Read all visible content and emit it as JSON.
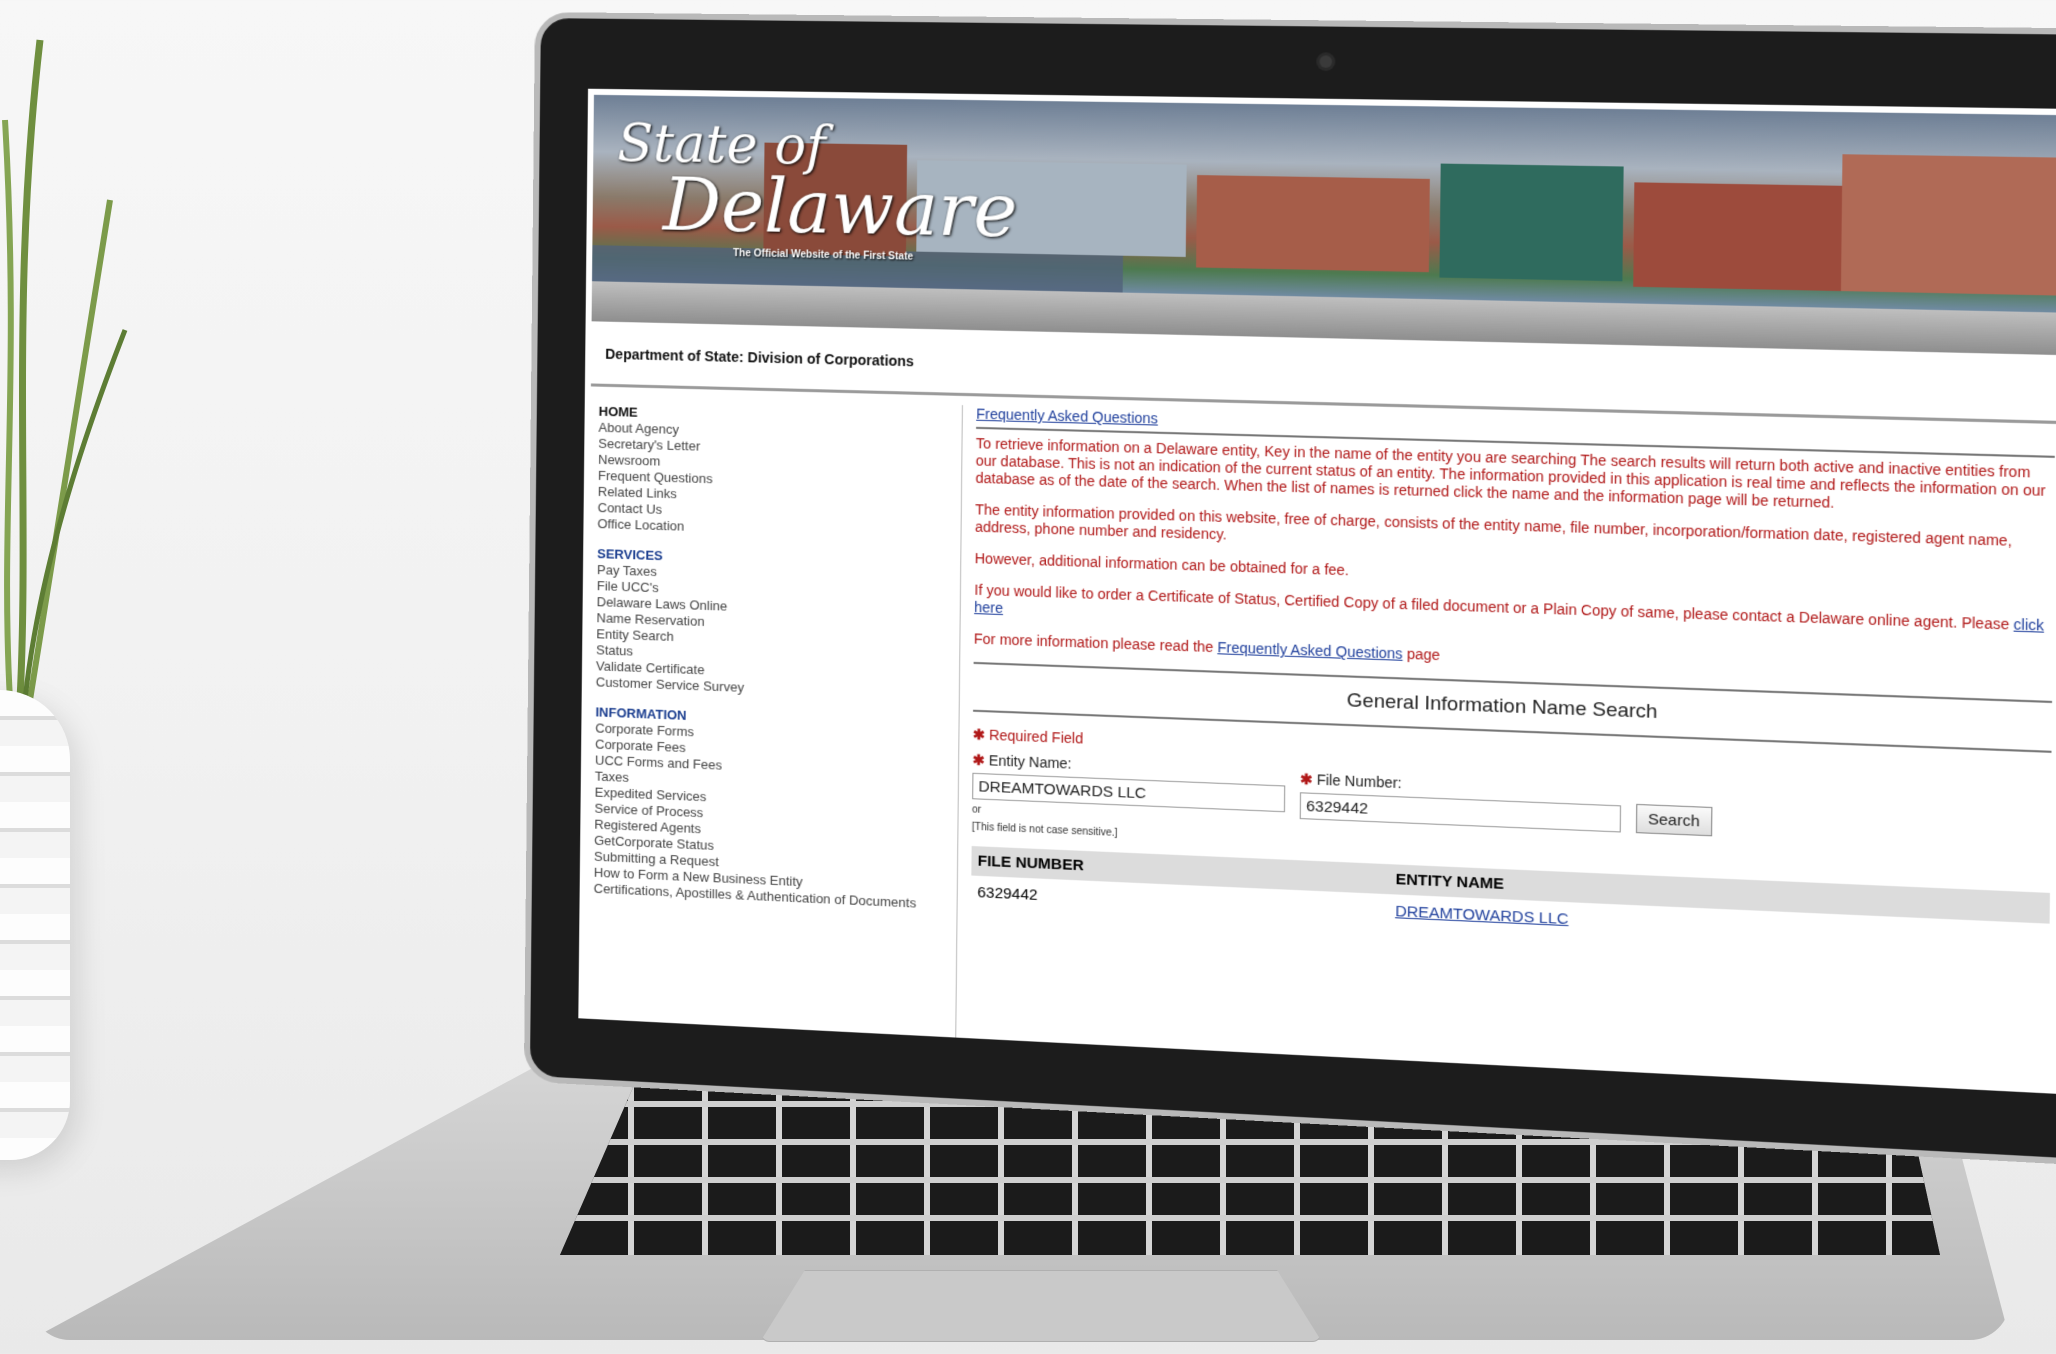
{
  "site": {
    "logo_state": "State of",
    "logo_name": "Delaware",
    "logo_tagline": "The Official Website of the First State",
    "department": "Department of State: Division of Corporations"
  },
  "nav": {
    "home": "HOME",
    "home_items": [
      "About Agency",
      "Secretary's Letter",
      "Newsroom",
      "Frequent Questions",
      "Related Links",
      "Contact Us",
      "Office Location"
    ],
    "services": "SERVICES",
    "services_items": [
      "Pay Taxes",
      "File UCC's",
      "Delaware Laws Online",
      "Name Reservation",
      "Entity Search",
      "Status",
      "Validate Certificate",
      "Customer Service Survey"
    ],
    "information": "INFORMATION",
    "information_items": [
      "Corporate Forms",
      "Corporate Fees",
      "UCC Forms and Fees",
      "Taxes",
      "Expedited Services",
      "Service of Process",
      "Registered Agents",
      "GetCorporate Status",
      "Submitting a Request",
      "How to Form a New Business Entity",
      "Certifications, Apostilles & Authentication of Documents"
    ]
  },
  "content": {
    "faq_link": "Frequently Asked Questions",
    "para1": "To retrieve information on a Delaware entity, Key in the name of the entity you are searching The search results will return both active and inactive entities from our database. This is not an indication of the current status of an entity. The information provided in this application is real time and reflects the information on our database as of the date of the search. When the list of names is returned click the name and the information page will be returned.",
    "para2": "The entity information provided on this website, free of charge, consists of the entity name, file number, incorporation/formation date, registered agent name, address, phone number and residency.",
    "para3": "However, additional information can be obtained for a fee.",
    "para4_prefix": "If you would like to order a Certificate of Status, Certified Copy of a filed document or a Plain Copy of same, please contact a Delaware online agent. Please ",
    "para4_link": "click here",
    "para5_prefix": "For more information please read the ",
    "para5_link": "Frequently Asked Questions",
    "para5_suffix": " page"
  },
  "search": {
    "title": "General Information Name Search",
    "required": "Required Field",
    "entity_label": "Entity Name:",
    "entity_value": "DREAMTOWARDS LLC",
    "file_label": "File Number:",
    "file_value": "6329442",
    "or": "or",
    "note": "[This field is not case sensitive.]",
    "button": "Search"
  },
  "results": {
    "headers": [
      "FILE NUMBER",
      "ENTITY NAME"
    ],
    "rows": [
      [
        "6329442",
        "DREAMTOWARDS LLC"
      ]
    ]
  }
}
